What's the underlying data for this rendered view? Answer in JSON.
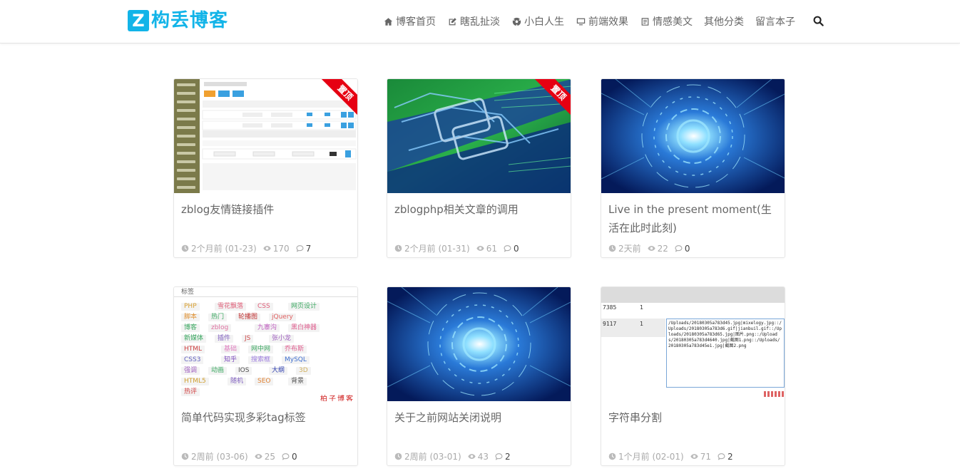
{
  "header": {
    "logo_letter": "Z",
    "logo_text": "构丢博客",
    "nav": [
      {
        "label": "博客首页",
        "icon": "home-icon"
      },
      {
        "label": "瞎乱扯淡",
        "icon": "edit-icon"
      },
      {
        "label": "小白人生",
        "icon": "soccer-ball-icon"
      },
      {
        "label": "前端效果",
        "icon": "monitor-icon"
      },
      {
        "label": "情感美文",
        "icon": "document-icon"
      },
      {
        "label": "其他分类",
        "icon": ""
      },
      {
        "label": "留言本子",
        "icon": ""
      }
    ],
    "search_icon": "search-icon"
  },
  "colors": {
    "accent": "#12b4e8",
    "ribbon": "#e60012",
    "text": "#666666",
    "meta": "#aaaaaa"
  },
  "posts": [
    {
      "title": "zblog友情链接插件",
      "time": "2个月前 (01-23)",
      "views": "170",
      "comments": "7",
      "pinned": true,
      "ribbon": "置顶",
      "thumb": "admin-screenshot"
    },
    {
      "title": "zblogphp相关文章的调用",
      "time": "2个月前 (01-31)",
      "views": "61",
      "comments": "0",
      "pinned": true,
      "ribbon": "置顶",
      "thumb": "circuit-board"
    },
    {
      "title": "Live in the present moment(生活在此时此刻)",
      "time": "2天前",
      "views": "22",
      "comments": "0",
      "pinned": false,
      "thumb": "blue-tech"
    },
    {
      "title": "简单代码实现多彩tag标签",
      "time": "2周前 (03-06)",
      "views": "25",
      "comments": "0",
      "pinned": false,
      "thumb": "tag-cloud"
    },
    {
      "title": "关于之前网站关闭说明",
      "time": "2周前 (03-01)",
      "views": "43",
      "comments": "2",
      "pinned": false,
      "thumb": "blue-tech"
    },
    {
      "title": "字符串分割",
      "time": "1个月前 (02-01)",
      "views": "71",
      "comments": "2",
      "pinned": false,
      "thumb": "code-screenshot"
    }
  ],
  "tag_thumb": {
    "heading": "标签",
    "tags": [
      {
        "t": "PHP",
        "c": "#d8a030"
      },
      {
        "t": "雪花飘落",
        "c": "#e0607a"
      },
      {
        "t": "CSS",
        "c": "#e0607a"
      },
      {
        "t": "网页设计",
        "c": "#3aa860"
      },
      {
        "t": "脚本",
        "c": "#e09030"
      },
      {
        "t": "热门",
        "c": "#3aa860"
      },
      {
        "t": "轮播图",
        "c": "#c03030"
      },
      {
        "t": "jQuery",
        "c": "#e06060"
      },
      {
        "t": "博客",
        "c": "#3aa860"
      },
      {
        "t": "zblog",
        "c": "#e070a0"
      },
      {
        "t": "九寨沟",
        "c": "#c060c0"
      },
      {
        "t": "黑白神器",
        "c": "#e06090"
      },
      {
        "t": "新媒体",
        "c": "#3aa860"
      },
      {
        "t": "插件",
        "c": "#8060c0"
      },
      {
        "t": "JS",
        "c": "#d05050"
      },
      {
        "t": "张小龙",
        "c": "#a060c0"
      },
      {
        "t": "HTML",
        "c": "#d04040"
      },
      {
        "t": "基础",
        "c": "#e080c0"
      },
      {
        "t": "网中网",
        "c": "#3aa860"
      },
      {
        "t": "乔布斯",
        "c": "#e06090"
      },
      {
        "t": "CSS3",
        "c": "#6060c0"
      },
      {
        "t": "知乎",
        "c": "#8050c0"
      },
      {
        "t": "搜索框",
        "c": "#a080e0"
      },
      {
        "t": "MySQL",
        "c": "#4070d0"
      },
      {
        "t": "强调",
        "c": "#a060c0"
      },
      {
        "t": "动画",
        "c": "#3aa860"
      },
      {
        "t": "IOS",
        "c": "#505050"
      },
      {
        "t": "大纲",
        "c": "#3040b0"
      },
      {
        "t": "3D",
        "c": "#d0b060"
      },
      {
        "t": "HTML5",
        "c": "#d0a030"
      },
      {
        "t": "随机",
        "c": "#8060c0"
      },
      {
        "t": "SEO",
        "c": "#e08030"
      },
      {
        "t": "背景",
        "c": "#505050"
      },
      {
        "t": "热评",
        "c": "#d04040"
      }
    ],
    "watermark": "柏子博客"
  },
  "code_thumb": {
    "rows": [
      "7385",
      "9117"
    ],
    "col": "1",
    "textarea": "/Uploads/20180305a783d45.jpg|mixelogy.jpg::/Uploads/20180305a783d6.gif|jianbuil.gif::/Uploads/20180305a783d65.jpg|图片.png::/Uploads/20180305a783d4640.jpg|截图1.png::/Uploads/20180305a783d45e1.jpg|截图2.png"
  }
}
